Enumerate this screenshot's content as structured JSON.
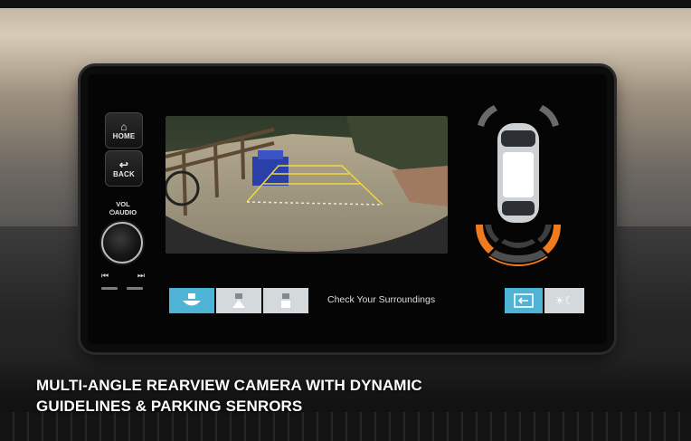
{
  "side_buttons": {
    "home": {
      "label": "HOME",
      "icon": "home-icon"
    },
    "back": {
      "label": "BACK",
      "icon": "back-arrow-icon"
    },
    "vol_audio_line1": "VOL",
    "vol_audio_line2": "AUDIO",
    "prev_track": "⏮",
    "next_track": "⏭"
  },
  "camera_view": {
    "mode": "normal",
    "guideline_color": "#f0d83a"
  },
  "view_modes": [
    {
      "name": "wide-view",
      "active": true
    },
    {
      "name": "normal-view",
      "active": false
    },
    {
      "name": "top-down-view",
      "active": false
    }
  ],
  "status": {
    "message": "Check Your Surroundings"
  },
  "right_buttons": {
    "exit_icon": "exit-icon",
    "brightness_icon": "sun-moon-icon"
  },
  "colors": {
    "accent_active": "#4fb3d6",
    "inactive_button": "#d4d9dc",
    "sensor_alert": "#f07a1e",
    "sensor_inactive": "#4e4e4e"
  },
  "caption": {
    "line1": "MULTI-ANGLE REARVIEW CAMERA WITH DYNAMIC",
    "line2": "GUIDELINES & PARKING SENRORS"
  }
}
